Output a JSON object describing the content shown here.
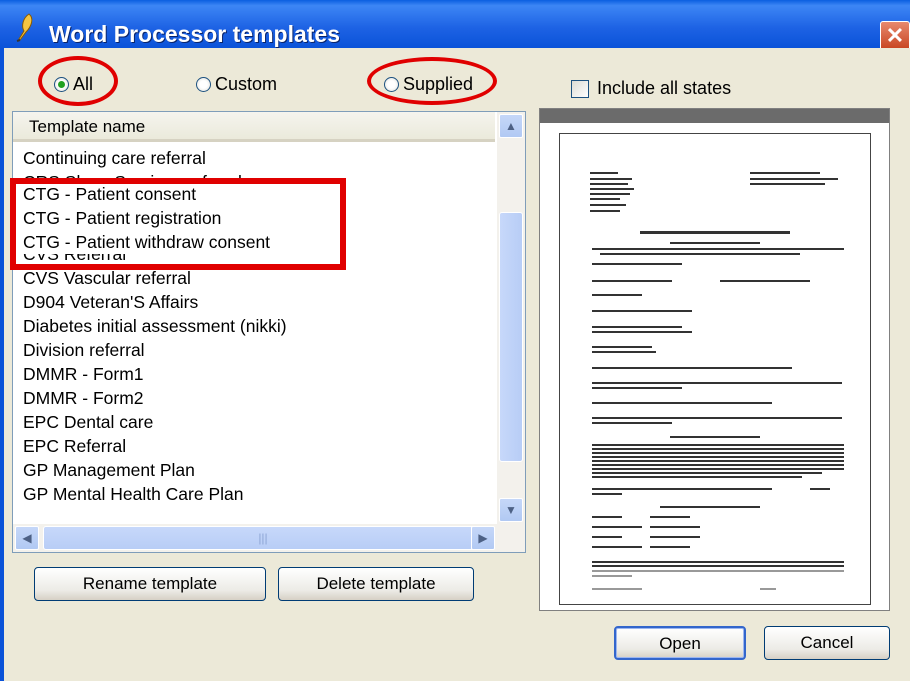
{
  "window": {
    "title": "Word Processor templates",
    "close_glyph": "✕",
    "icon": "quill-icon"
  },
  "filter": {
    "options": [
      {
        "label": "All",
        "selected": true
      },
      {
        "label": "Custom",
        "selected": false
      },
      {
        "label": "Supplied",
        "selected": false
      }
    ]
  },
  "include_all_states": {
    "label": "Include all states",
    "checked": false
  },
  "template_list": {
    "header": "Template name",
    "items": [
      "Continuing care referral",
      "CRS Sleep Services referral",
      "CTG - Patient consent",
      "CTG - Patient registration",
      "CTG - Patient withdraw consent",
      "CVS Referral",
      "CVS Vascular referral",
      "D904 Veteran'S Affairs",
      "Diabetes initial assessment (nikki)",
      "Division referral",
      "DMMR - Form1",
      "DMMR - Form2",
      "EPC Dental care",
      "EPC Referral",
      "GP Management Plan",
      "GP Mental Health Care Plan"
    ]
  },
  "buttons": {
    "rename": "Rename template",
    "delete": "Delete template",
    "open": "Open",
    "cancel": "Cancel"
  },
  "colors": {
    "title_bar": "#0a52d8",
    "annotation_red": "#e00000",
    "radio_selected": "#21a121"
  }
}
